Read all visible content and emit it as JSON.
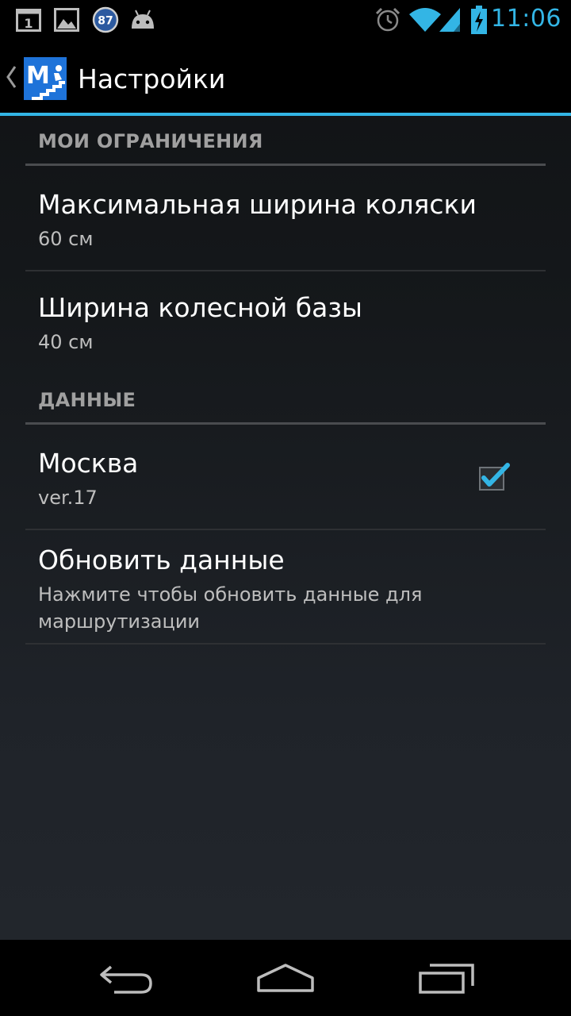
{
  "status_bar": {
    "notifications": [
      {
        "icon": "notification-calendar-icon",
        "text": "1"
      },
      {
        "icon": "gallery-image-icon"
      },
      {
        "icon": "badge-icon",
        "text": "87"
      },
      {
        "icon": "android-icon"
      }
    ],
    "alarm_icon": "alarm-clock-icon",
    "wifi_icon": "wifi-icon",
    "signal_icon": "cell-signal-icon",
    "battery_icon": "battery-charging-icon",
    "time": "11:06"
  },
  "action_bar": {
    "up_icon": "back-caret-icon",
    "logo_letter": "M",
    "logo_color": "#1e73d9",
    "title": "Настройки",
    "accent_color": "#33b5e5"
  },
  "preferences": {
    "categories": [
      {
        "title": "МОИ ОГРАНИЧЕНИЯ",
        "items": [
          {
            "title": "Максимальная ширина коляски",
            "summary": "60 см"
          },
          {
            "title": "Ширина колесной базы",
            "summary": "40 см"
          }
        ]
      },
      {
        "title": "ДАННЫЕ",
        "items": [
          {
            "title": "Москва",
            "summary": "ver.17",
            "checked": true
          },
          {
            "title": "Обновить данные",
            "summary": "Нажмите чтобы обновить данные для маршрутизации"
          }
        ]
      }
    ]
  },
  "nav_bar": {
    "back_icon": "back-arrow-icon",
    "home_icon": "home-icon",
    "recents_icon": "recent-apps-icon"
  }
}
